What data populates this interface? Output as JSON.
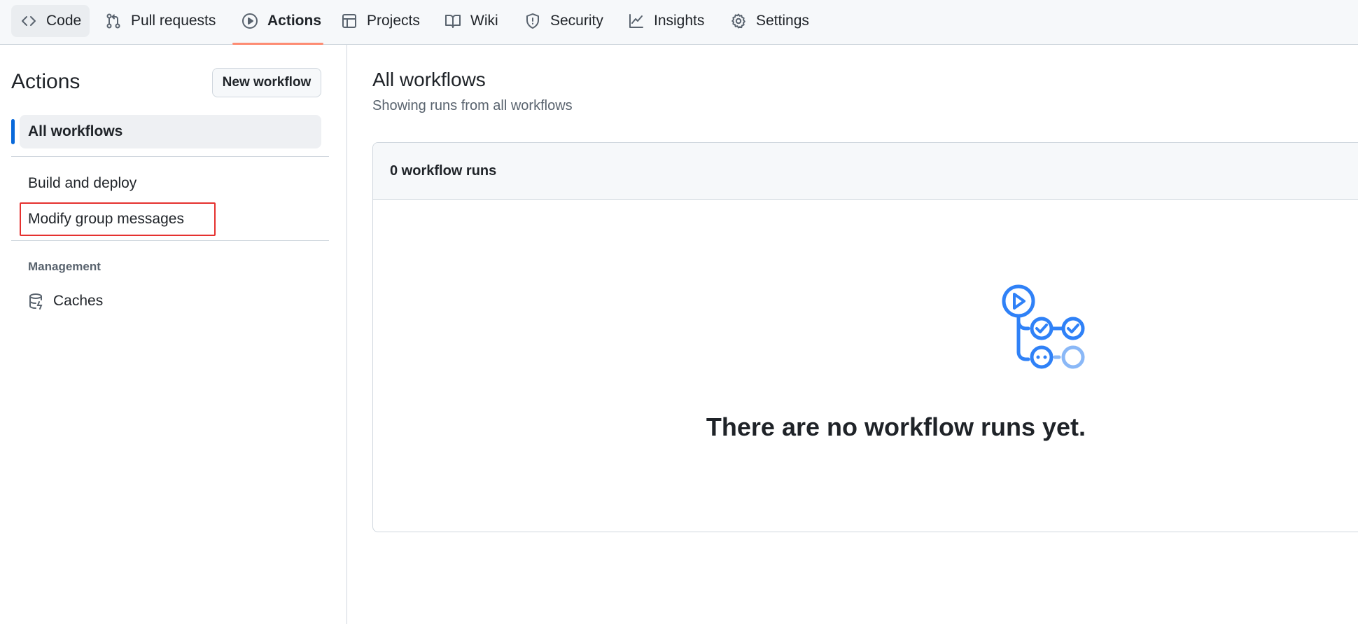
{
  "nav": {
    "tabs": [
      {
        "label": "Code",
        "icon": "code-icon"
      },
      {
        "label": "Pull requests",
        "icon": "git-pull-request-icon"
      },
      {
        "label": "Actions",
        "icon": "play-circle-icon",
        "active": true
      },
      {
        "label": "Projects",
        "icon": "table-icon"
      },
      {
        "label": "Wiki",
        "icon": "book-icon"
      },
      {
        "label": "Security",
        "icon": "shield-icon"
      },
      {
        "label": "Insights",
        "icon": "graph-icon"
      },
      {
        "label": "Settings",
        "icon": "gear-icon"
      }
    ],
    "active_underline_color": "#fd8c73"
  },
  "sidebar": {
    "title": "Actions",
    "new_workflow_label": "New workflow",
    "all_workflows_label": "All workflows",
    "workflows": [
      "Build and deploy",
      "Modify group messages"
    ],
    "management_heading": "Management",
    "caches_label": "Caches",
    "selection_color": "#0969da",
    "highlight_box_color": "#e5312f"
  },
  "main": {
    "title": "All workflows",
    "subtitle": "Showing runs from all workflows",
    "runs_count_label": "0 workflow runs",
    "empty_message": "There are no workflow runs yet.",
    "illustration_icon": "workflow-empty-state-icon",
    "accent_color": "#2f81f7"
  }
}
